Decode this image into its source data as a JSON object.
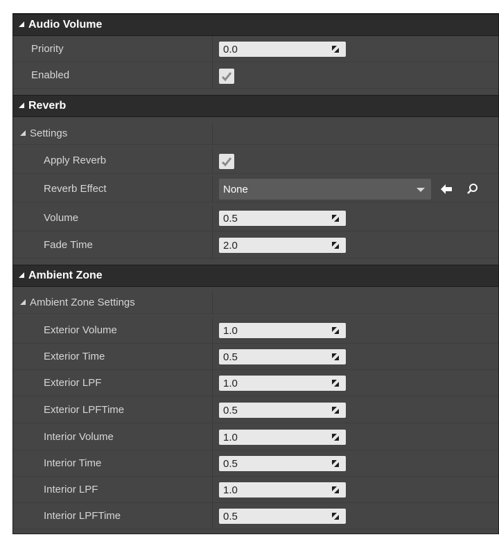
{
  "sections": {
    "audio_volume": {
      "title": "Audio Volume",
      "priority": {
        "label": "Priority",
        "value": "0.0"
      },
      "enabled": {
        "label": "Enabled",
        "checked": true
      }
    },
    "reverb": {
      "title": "Reverb",
      "settings_group": "Settings",
      "apply_reverb": {
        "label": "Apply Reverb",
        "checked": true
      },
      "reverb_effect": {
        "label": "Reverb Effect",
        "value": "None"
      },
      "volume": {
        "label": "Volume",
        "value": "0.5"
      },
      "fade_time": {
        "label": "Fade Time",
        "value": "2.0"
      }
    },
    "ambient_zone": {
      "title": "Ambient Zone",
      "settings_group": "Ambient Zone Settings",
      "fields": [
        {
          "label": "Exterior Volume",
          "value": "1.0"
        },
        {
          "label": "Exterior Time",
          "value": "0.5"
        },
        {
          "label": "Exterior LPF",
          "value": "1.0"
        },
        {
          "label": "Exterior LPFTime",
          "value": "0.5"
        },
        {
          "label": "Interior Volume",
          "value": "1.0"
        },
        {
          "label": "Interior Time",
          "value": "0.5"
        },
        {
          "label": "Interior LPF",
          "value": "1.0"
        },
        {
          "label": "Interior LPFTime",
          "value": "0.5"
        }
      ]
    }
  },
  "icons": {
    "collapse": "triangle-down-right-icon",
    "resize": "diagonal-resize-icon",
    "check": "checkmark-icon",
    "use_selected": "arrow-left-icon",
    "browse": "search-icon",
    "dropdown": "chevron-down-icon"
  }
}
